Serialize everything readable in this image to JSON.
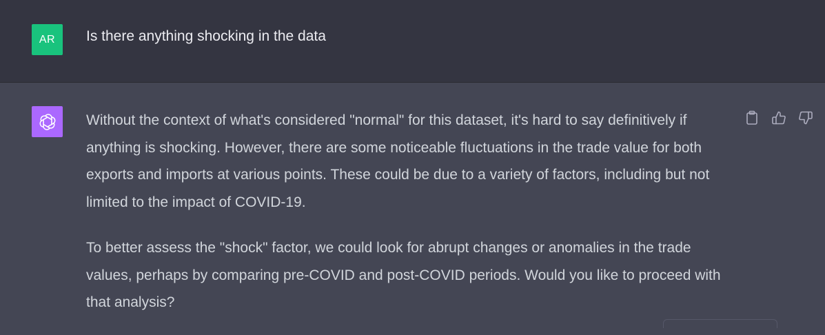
{
  "user_message": {
    "avatar_initials": "AR",
    "avatar_color": "#19c37d",
    "text": "Is there anything shocking in the data"
  },
  "assistant_message": {
    "avatar_icon": "openai-logo-icon",
    "avatar_color": "#ab68ff",
    "paragraphs": [
      "Without the context of what's considered \"normal\" for this dataset, it's hard to say definitively if anything is shocking. However, there are some noticeable fluctuations in the trade value for both exports and imports at various points. These could be due to a variety of factors, including but not limited to the impact of COVID-19.",
      "To better assess the \"shock\" factor, we could look for abrupt changes or anomalies in the trade values, perhaps by comparing pre-COVID and post-COVID periods. Would you like to proceed with that analysis?"
    ],
    "actions": [
      "copy-icon",
      "thumbs-up-icon",
      "thumbs-down-icon"
    ]
  }
}
